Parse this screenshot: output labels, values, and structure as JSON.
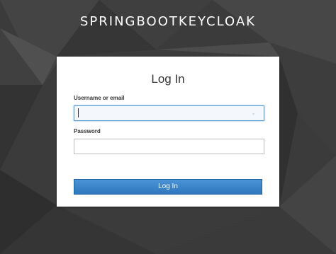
{
  "realm": {
    "title": "SPRINGBOOTKEYCLOAK"
  },
  "login": {
    "title": "Log In",
    "username_label": "Username or email",
    "username_value": "",
    "password_label": "Password",
    "password_value": "",
    "submit_label": "Log In"
  },
  "colors": {
    "background": "#3a3a3a",
    "card": "#ffffff",
    "button": "#3a86cc",
    "focus_border": "#5d9ad3"
  }
}
